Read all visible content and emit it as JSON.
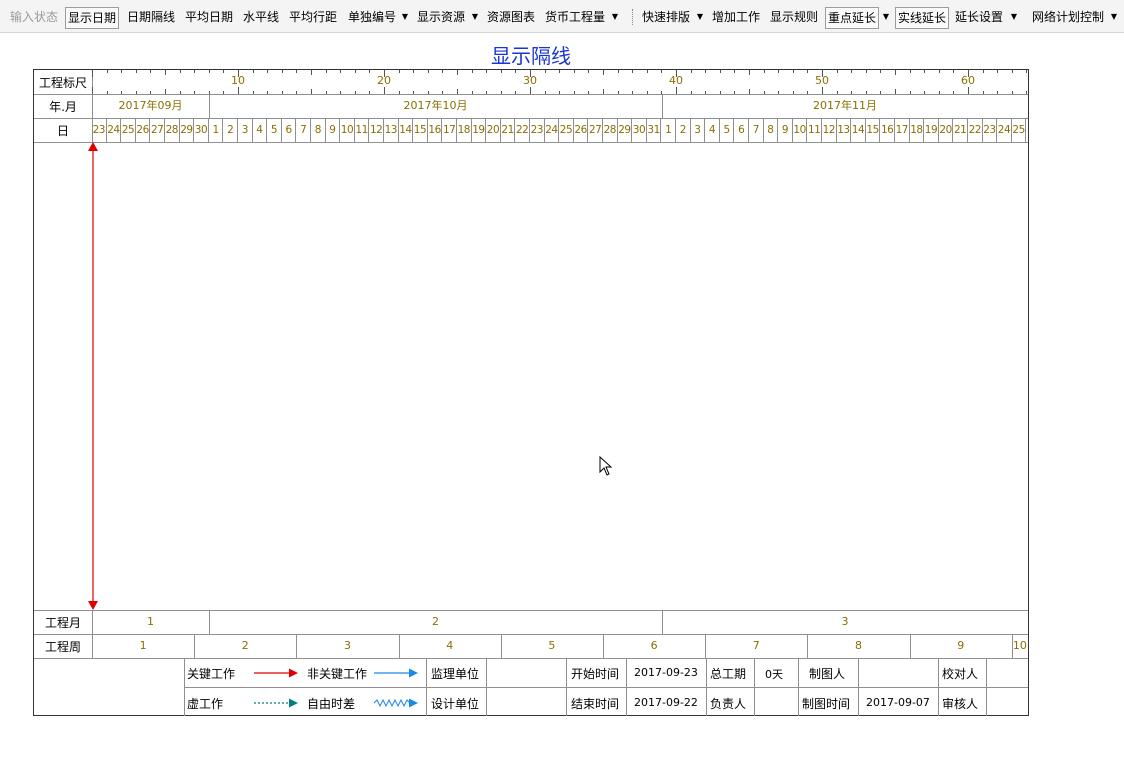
{
  "toolbar": {
    "items": [
      {
        "label": "输入状态"
      },
      {
        "label": "显示日期"
      },
      {
        "label": "日期隔线"
      },
      {
        "label": "平均日期"
      },
      {
        "label": "水平线"
      },
      {
        "label": "平均行距"
      },
      {
        "label": "单独编号"
      },
      {
        "label": "显示资源"
      },
      {
        "label": "资源图表"
      },
      {
        "label": "货币工程量"
      },
      {
        "label": "快速排版"
      },
      {
        "label": "增加工作"
      },
      {
        "label": "显示规则"
      },
      {
        "label": "重点延长"
      },
      {
        "label": "实线延长"
      },
      {
        "label": "延长设置"
      },
      {
        "label": "网络计划控制"
      }
    ]
  },
  "page_title": "显示隔线",
  "chart": {
    "row_labels": {
      "ruler": "工程标尺",
      "year_month": "年.月",
      "day": "日",
      "project_month": "工程月",
      "project_week": "工程周"
    },
    "ruler_numbers": [
      "10",
      "20",
      "30",
      "40",
      "50",
      "60"
    ],
    "months": [
      "2017年09月",
      "2017年10月",
      "2017年11月"
    ],
    "days": [
      "23",
      "24",
      "25",
      "26",
      "27",
      "28",
      "29",
      "30",
      "1",
      "2",
      "3",
      "4",
      "5",
      "6",
      "7",
      "8",
      "9",
      "10",
      "11",
      "12",
      "13",
      "14",
      "15",
      "16",
      "17",
      "18",
      "19",
      "20",
      "21",
      "22",
      "23",
      "24",
      "25",
      "26",
      "27",
      "28",
      "29",
      "30",
      "31",
      "1",
      "2",
      "3",
      "4",
      "5",
      "6",
      "7",
      "8",
      "9",
      "10",
      "11",
      "12",
      "13",
      "14",
      "15",
      "16",
      "17",
      "18",
      "19",
      "20",
      "21",
      "22",
      "23",
      "24",
      "25"
    ],
    "project_months": [
      "1",
      "2",
      "3"
    ],
    "project_weeks": [
      "1",
      "2",
      "3",
      "4",
      "5",
      "6",
      "7",
      "8",
      "9",
      "10"
    ]
  },
  "legend": {
    "critical": "关键工作",
    "noncritical": "非关键工作",
    "dummy": "虚工作",
    "free_float": "自由时差",
    "supervisor_unit": "监理单位",
    "design_unit": "设计单位",
    "start_time_label": "开始时间",
    "start_time": "2017-09-23",
    "end_time_label": "结束时间",
    "end_time": "2017-09-22",
    "total_duration_label": "总工期",
    "total_duration": "0天",
    "responsible_label": "负责人",
    "drafter_label": "制图人",
    "draw_time_label": "制图时间",
    "draw_time": "2017-09-07",
    "checker_label": "校对人",
    "reviewer_label": "审核人"
  },
  "colors": {
    "title": "#1a35d6",
    "critical": "#e00000",
    "noncritical": "#1e88e5",
    "dummy": "#008080",
    "axis_text": "#8a7000"
  }
}
